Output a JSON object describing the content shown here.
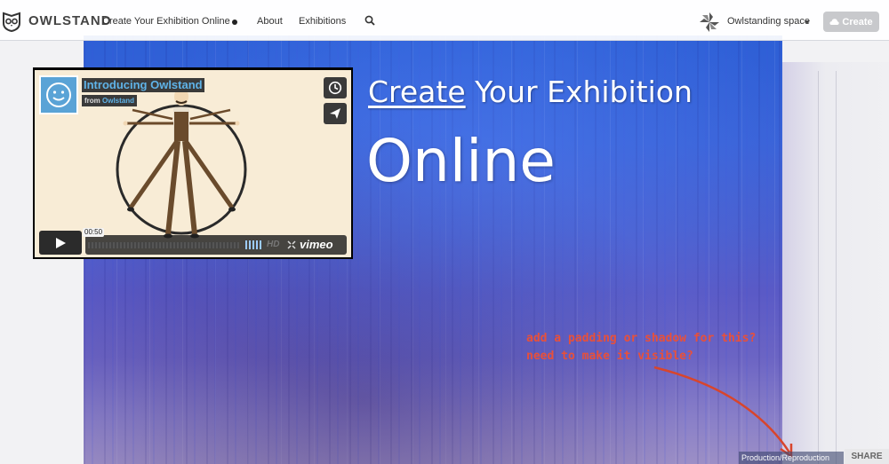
{
  "header": {
    "brand": "OWLSTAND",
    "tagline": "Create Your Exhibition Online",
    "nav": {
      "about": "About",
      "exhibitions": "Exhibitions"
    },
    "space_name": "Owlstanding space",
    "create_label": "Create"
  },
  "video": {
    "title": "Introducing Owlstand",
    "from_prefix": "from",
    "owner": "Owlstand",
    "time": "00:50",
    "hd": "HD",
    "provider": "vimeo"
  },
  "hero": {
    "line1_underlined": "Create",
    "line1_rest": " Your Exhibition",
    "line2": "Online"
  },
  "annotation": {
    "text": "add a padding or shadow for this?\nneed to make it visible?"
  },
  "footer": {
    "credit": "Production/Reproduction",
    "share": "SHARE"
  },
  "colors": {
    "annotation": "#e8503a",
    "video_title": "#5fb3e8",
    "create_button": "#c8c9cc"
  },
  "icons": [
    "owl-logo-icon",
    "search-icon",
    "space-logo-icon",
    "cloud-icon",
    "clock-icon",
    "send-icon",
    "play-icon",
    "fullscreen-icon",
    "smiley-avatar-icon"
  ]
}
